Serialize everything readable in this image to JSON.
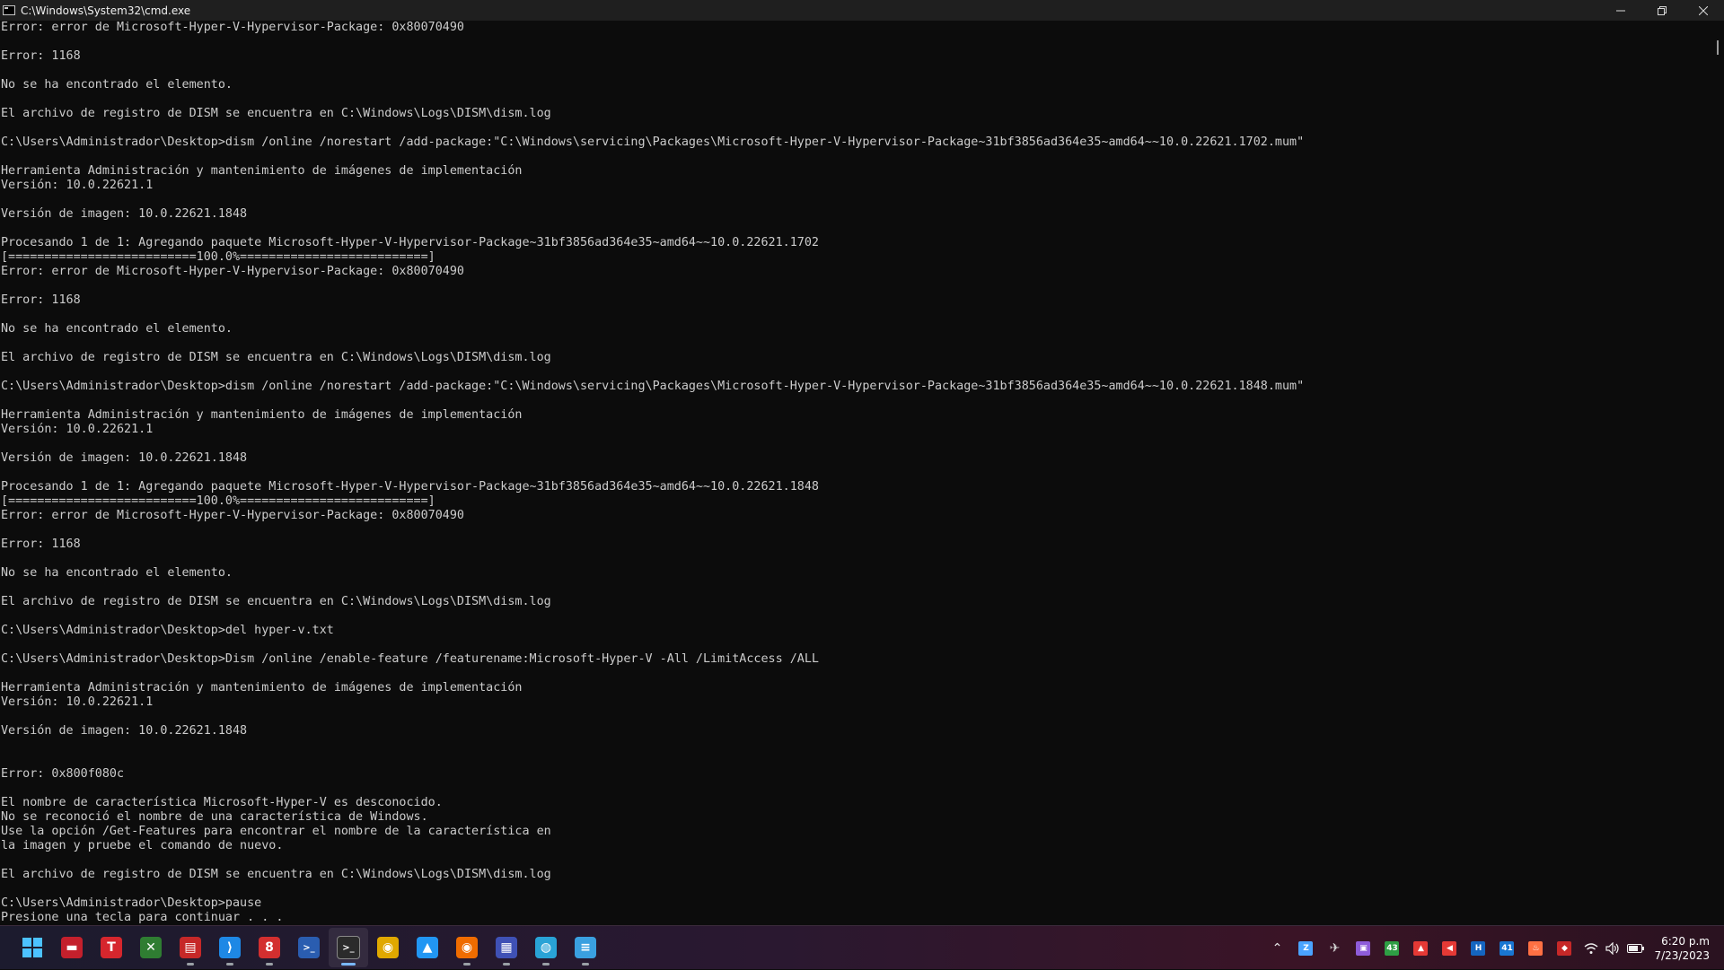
{
  "window": {
    "title": "C:\\Windows\\System32\\cmd.exe",
    "minimize_icon": "minimize-icon",
    "restore_icon": "restore-icon",
    "close_icon": "close-icon"
  },
  "console": {
    "lines": [
      "Error: error de Microsoft-Hyper-V-Hypervisor-Package: 0x80070490",
      "",
      "Error: 1168",
      "",
      "No se ha encontrado el elemento.",
      "",
      "El archivo de registro de DISM se encuentra en C:\\Windows\\Logs\\DISM\\dism.log",
      "",
      "C:\\Users\\Administrador\\Desktop>dism /online /norestart /add-package:\"C:\\Windows\\servicing\\Packages\\Microsoft-Hyper-V-Hypervisor-Package~31bf3856ad364e35~amd64~~10.0.22621.1702.mum\"",
      "",
      "Herramienta Administración y mantenimiento de imágenes de implementación",
      "Versión: 10.0.22621.1",
      "",
      "Versión de imagen: 10.0.22621.1848",
      "",
      "Procesando 1 de 1: Agregando paquete Microsoft-Hyper-V-Hypervisor-Package~31bf3856ad364e35~amd64~~10.0.22621.1702",
      "[==========================100.0%==========================]",
      "Error: error de Microsoft-Hyper-V-Hypervisor-Package: 0x80070490",
      "",
      "Error: 1168",
      "",
      "No se ha encontrado el elemento.",
      "",
      "El archivo de registro de DISM se encuentra en C:\\Windows\\Logs\\DISM\\dism.log",
      "",
      "C:\\Users\\Administrador\\Desktop>dism /online /norestart /add-package:\"C:\\Windows\\servicing\\Packages\\Microsoft-Hyper-V-Hypervisor-Package~31bf3856ad364e35~amd64~~10.0.22621.1848.mum\"",
      "",
      "Herramienta Administración y mantenimiento de imágenes de implementación",
      "Versión: 10.0.22621.1",
      "",
      "Versión de imagen: 10.0.22621.1848",
      "",
      "Procesando 1 de 1: Agregando paquete Microsoft-Hyper-V-Hypervisor-Package~31bf3856ad364e35~amd64~~10.0.22621.1848",
      "[==========================100.0%==========================]",
      "Error: error de Microsoft-Hyper-V-Hypervisor-Package: 0x80070490",
      "",
      "Error: 1168",
      "",
      "No se ha encontrado el elemento.",
      "",
      "El archivo de registro de DISM se encuentra en C:\\Windows\\Logs\\DISM\\dism.log",
      "",
      "C:\\Users\\Administrador\\Desktop>del hyper-v.txt",
      "",
      "C:\\Users\\Administrador\\Desktop>Dism /online /enable-feature /featurename:Microsoft-Hyper-V -All /LimitAccess /ALL",
      "",
      "Herramienta Administración y mantenimiento de imágenes de implementación",
      "Versión: 10.0.22621.1",
      "",
      "Versión de imagen: 10.0.22621.1848",
      "",
      "",
      "Error: 0x800f080c",
      "",
      "El nombre de característica Microsoft-Hyper-V es desconocido.",
      "No se reconoció el nombre de una característica de Windows.",
      "Use la opción /Get-Features para encontrar el nombre de la característica en",
      "la imagen y pruebe el comando de nuevo.",
      "",
      "El archivo de registro de DISM se encuentra en C:\\Windows\\Logs\\DISM\\dism.log",
      "",
      "C:\\Users\\Administrador\\Desktop>pause",
      "Presione una tecla para continuar . . ."
    ]
  },
  "taskbar": {
    "apps": [
      {
        "name": "start-button",
        "icon": "windows-start-icon",
        "glyph": "",
        "color": "#4cc2ff",
        "active": false,
        "indicator": false
      },
      {
        "name": "taskbar-app-red-car",
        "icon": "red-car-app-icon",
        "glyph": "▬",
        "color": "#c4202c",
        "active": false,
        "indicator": false
      },
      {
        "name": "taskbar-app-t",
        "icon": "t-app-icon",
        "glyph": "T",
        "color": "#d6262d",
        "active": false,
        "indicator": false
      },
      {
        "name": "taskbar-app-xbox",
        "icon": "xbox-icon",
        "glyph": "✕",
        "color": "#2f7d32",
        "active": false,
        "indicator": false
      },
      {
        "name": "taskbar-app-save",
        "icon": "floppy-disk-icon",
        "glyph": "▤",
        "color": "#c62828",
        "active": false,
        "indicator": true
      },
      {
        "name": "taskbar-app-vscode",
        "icon": "vscode-icon",
        "glyph": "⟩",
        "color": "#1e88e5",
        "active": false,
        "indicator": true
      },
      {
        "name": "taskbar-app-8",
        "icon": "eight-app-icon",
        "glyph": "8",
        "color": "#d32f2f",
        "active": false,
        "indicator": true
      },
      {
        "name": "taskbar-app-powershell",
        "icon": "powershell-icon",
        "glyph": ">_",
        "color": "#2a5db0",
        "active": false,
        "indicator": false
      },
      {
        "name": "taskbar-app-terminal",
        "icon": "terminal-icon",
        "glyph": ">_",
        "color": "#2b2b2b",
        "active": true,
        "indicator": true
      },
      {
        "name": "taskbar-app-chrome",
        "icon": "chrome-icon",
        "glyph": "◉",
        "color": "#e0a800",
        "active": false,
        "indicator": false
      },
      {
        "name": "taskbar-app-a",
        "icon": "a-app-icon",
        "glyph": "▲",
        "color": "#2196f3",
        "active": false,
        "indicator": false
      },
      {
        "name": "taskbar-app-chrome-canary",
        "icon": "chrome-canary-icon",
        "glyph": "◉",
        "color": "#ef6c00",
        "active": false,
        "indicator": true
      },
      {
        "name": "taskbar-app-outlook",
        "icon": "outlook-icon",
        "glyph": "▦",
        "color": "#3f51b5",
        "active": false,
        "indicator": true
      },
      {
        "name": "taskbar-app-globe",
        "icon": "globe-icon",
        "glyph": "◍",
        "color": "#29a3d6",
        "active": false,
        "indicator": true
      },
      {
        "name": "taskbar-app-notepad",
        "icon": "notepad-icon",
        "glyph": "≡",
        "color": "#3aa0e0",
        "active": false,
        "indicator": true
      }
    ],
    "tray": [
      {
        "name": "tray-overflow-chevron",
        "icon": "chevron-up-icon",
        "glyph": "⌃",
        "color": "#e6e6e6"
      },
      {
        "name": "tray-app-z",
        "icon": "z-app-icon",
        "glyph": "Z",
        "color": "#4aa3ff"
      },
      {
        "name": "tray-app-plane",
        "icon": "plane-icon",
        "glyph": "✈",
        "color": "#d0d0d0"
      },
      {
        "name": "tray-app-monitor",
        "icon": "monitor-icon",
        "glyph": "▣",
        "color": "#8e5cd9"
      },
      {
        "name": "tray-app-43",
        "icon": "temperature-badge-icon",
        "glyph": "43",
        "color": "#2e9e44"
      },
      {
        "name": "tray-app-warning",
        "icon": "warning-icon",
        "glyph": "▲",
        "color": "#e53935"
      },
      {
        "name": "tray-app-speaker-red",
        "icon": "red-speaker-icon",
        "glyph": "◀",
        "color": "#e53935"
      },
      {
        "name": "tray-app-h",
        "icon": "h-app-icon",
        "glyph": "H",
        "color": "#1565c0"
      },
      {
        "name": "tray-app-41",
        "icon": "cpu-badge-icon",
        "glyph": "41",
        "color": "#1976d2"
      },
      {
        "name": "tray-app-flame",
        "icon": "flame-icon",
        "glyph": "♨",
        "color": "#ff7043"
      },
      {
        "name": "tray-app-red",
        "icon": "red-app-icon",
        "glyph": "◆",
        "color": "#c62828"
      }
    ],
    "system": {
      "wifi_icon": "wifi-icon",
      "volume_icon": "volume-icon",
      "battery_icon": "battery-icon"
    },
    "clock": {
      "time": "6:20 p.m",
      "date": "7/23/2023"
    }
  }
}
